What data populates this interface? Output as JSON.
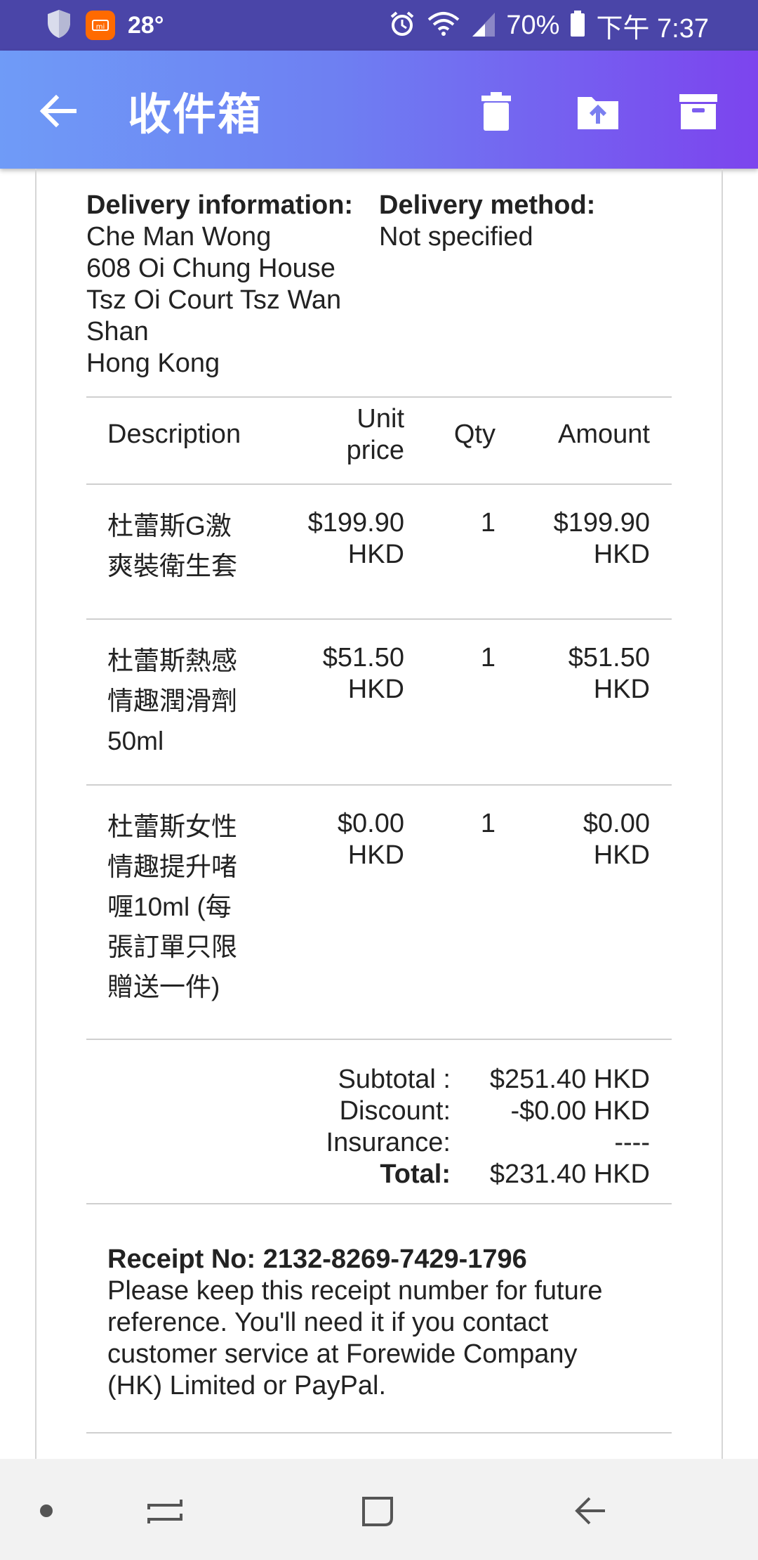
{
  "status_bar": {
    "temperature": "28°",
    "battery": "70%",
    "time": "下午 7:37",
    "icons": [
      "shield-icon",
      "mi-icon",
      "alarm-icon",
      "wifi-icon",
      "signal-icon",
      "battery-icon"
    ]
  },
  "app_bar": {
    "title": "收件箱",
    "actions": [
      "delete-icon",
      "move-to-icon",
      "archive-icon"
    ]
  },
  "delivery": {
    "info_heading": "Delivery information:",
    "name": "Che Man Wong",
    "line1": "608 Oi Chung House",
    "line2": "Tsz Oi Court Tsz Wan",
    "line3": "Shan",
    "line4": "Hong Kong",
    "method_heading": "Delivery method:",
    "method_value": "Not specified"
  },
  "table": {
    "headers": {
      "description": "Description",
      "unit_price_1": "Unit",
      "unit_price_2": "price",
      "qty": "Qty",
      "amount": "Amount"
    },
    "rows": [
      {
        "desc": [
          "杜蕾斯G激",
          "爽裝衛生套"
        ],
        "unit_price": [
          "$199.90",
          "HKD"
        ],
        "qty": "1",
        "amount": [
          "$199.90",
          "HKD"
        ]
      },
      {
        "desc": [
          "杜蕾斯熱感",
          "情趣潤滑劑",
          "50ml"
        ],
        "unit_price": [
          "$51.50",
          "HKD"
        ],
        "qty": "1",
        "amount": [
          "$51.50",
          "HKD"
        ]
      },
      {
        "desc": [
          "杜蕾斯女性",
          "情趣提升啫",
          "喱10ml (每",
          "張訂單只限",
          "贈送一件)"
        ],
        "unit_price": [
          "$0.00",
          "HKD"
        ],
        "qty": "1",
        "amount": [
          "$0.00",
          "HKD"
        ]
      }
    ]
  },
  "totals": {
    "subtotal_label": "Subtotal :",
    "subtotal_value": "$251.40 HKD",
    "discount_label": "Discount:",
    "discount_value": "-$0.00 HKD",
    "insurance_label": "Insurance:",
    "insurance_value": "----",
    "total_label": "Total:",
    "total_value": "$231.40 HKD"
  },
  "receipt": {
    "number_line": "Receipt No: 2132-8269-7429-1796",
    "note_1": "Please keep this receipt number for future",
    "note_2": "reference. You'll need it if you contact",
    "note_3": "customer service at Forewide Company",
    "note_4": "(HK) Limited or PayPal."
  },
  "nav_bar": {
    "icons": [
      "dot-icon",
      "recents-icon",
      "home-icon",
      "back-icon"
    ]
  }
}
